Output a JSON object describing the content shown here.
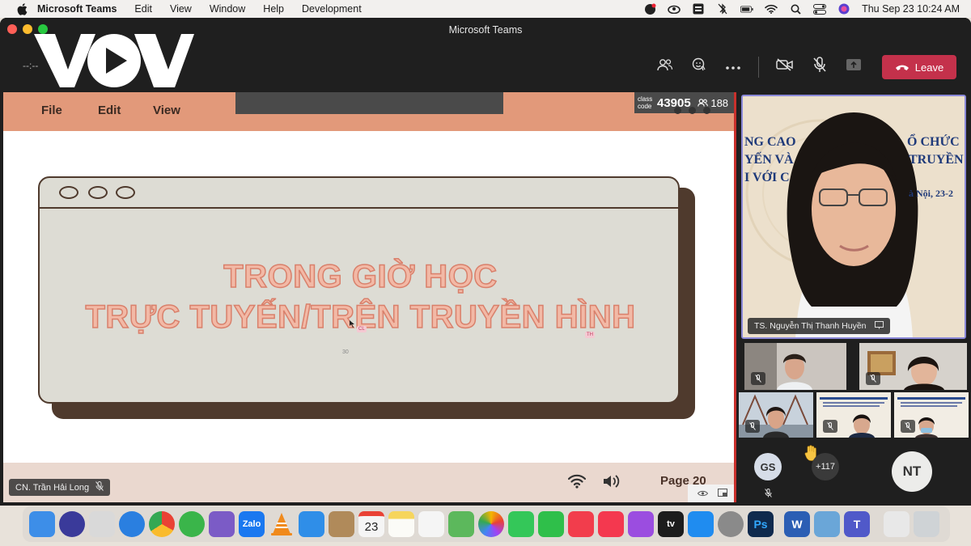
{
  "menubar": {
    "app_name": "Microsoft Teams",
    "items": [
      "Edit",
      "View",
      "Window",
      "Help",
      "Development"
    ],
    "clock": "Thu Sep 23  10:24 AM"
  },
  "window": {
    "title": "Microsoft Teams",
    "timer": "--:--",
    "leave_label": "Leave"
  },
  "logo": {
    "text": "VOV"
  },
  "slide": {
    "menu": [
      "File",
      "Edit",
      "View"
    ],
    "class_code_label": "class code",
    "class_code": "43905",
    "participant_count": "188",
    "title_line1": "TRONG GIỜ HỌC",
    "title_line2": "TRỰC TUYẾN/TRÊN TRUYỀN HÌNH",
    "page_label": "Page 20",
    "cursor_tag_cl": "CL",
    "cursor_tag_th": "TH",
    "small_number": "30"
  },
  "presenter": {
    "name": "CN. Trần Hải Long"
  },
  "gallery": {
    "main_name": "TS. Nguyễn Thị Thanh Huyền",
    "backdrop_lines": [
      "NG CAO",
      "Ổ CHỨC",
      "YẾN VÀ",
      "TRUYỀN",
      "I VỚI C",
      "à Nội, 23-2"
    ],
    "avatars": [
      {
        "initials": "GS",
        "color": "#d6dde8"
      },
      {
        "initials": "NT",
        "color": "#ececea"
      }
    ],
    "overflow_count": "+117"
  },
  "dock": {
    "apps": [
      {
        "name": "Finder",
        "label": "",
        "color": "#3d8ee8"
      },
      {
        "name": "Siri",
        "label": "",
        "color": "#3a3a9a"
      },
      {
        "name": "Launchpad",
        "label": "",
        "color": "#d9d9d9"
      },
      {
        "name": "Safari",
        "label": "",
        "color": "#2a7fe0"
      },
      {
        "name": "Chrome",
        "label": "",
        "color": "#e8e8e8"
      },
      {
        "name": "Duolingo",
        "label": "",
        "color": "#3ab54a"
      },
      {
        "name": "Viber",
        "label": "",
        "color": "#7b5bc6"
      },
      {
        "name": "Zalo",
        "label": "Zalo",
        "color": "#1a78f0"
      },
      {
        "name": "VLC",
        "label": "",
        "color": "#f08a1c"
      },
      {
        "name": "Mail",
        "label": "",
        "color": "#2f8ee8"
      },
      {
        "name": "Contacts",
        "label": "",
        "color": "#b08a5a"
      },
      {
        "name": "Calendar",
        "label": "23",
        "color": "#f5f5f5"
      },
      {
        "name": "Notes",
        "label": "",
        "color": "#f6d55c"
      },
      {
        "name": "Reminders",
        "label": "",
        "color": "#f5f5f5"
      },
      {
        "name": "Maps",
        "label": "",
        "color": "#5cb85c"
      },
      {
        "name": "Photos",
        "label": "",
        "color": "#f4f4f4"
      },
      {
        "name": "Messages",
        "label": "",
        "color": "#34c759"
      },
      {
        "name": "FaceTime",
        "label": "",
        "color": "#2fbf4a"
      },
      {
        "name": "News",
        "label": "",
        "color": "#f23d4c"
      },
      {
        "name": "Music",
        "label": "",
        "color": "#f4384f"
      },
      {
        "name": "Podcasts",
        "label": "",
        "color": "#9b4de0"
      },
      {
        "name": "TV",
        "label": "tv",
        "color": "#1c1c1c"
      },
      {
        "name": "App Store",
        "label": "",
        "color": "#1f8cf0"
      },
      {
        "name": "System Preferences",
        "label": "",
        "color": "#8a8a8a"
      },
      {
        "name": "Photoshop",
        "label": "Ps",
        "color": "#0f2a4d"
      },
      {
        "name": "Word",
        "label": "W",
        "color": "#2b5eb4"
      },
      {
        "name": "Preview",
        "label": "",
        "color": "#6aa6d8"
      },
      {
        "name": "Teams",
        "label": "T",
        "color": "#5059c9"
      },
      {
        "name": "Documents",
        "label": "",
        "color": "#e8e8e8"
      },
      {
        "name": "Trash",
        "label": "",
        "color": "#cfd3d6"
      }
    ]
  }
}
